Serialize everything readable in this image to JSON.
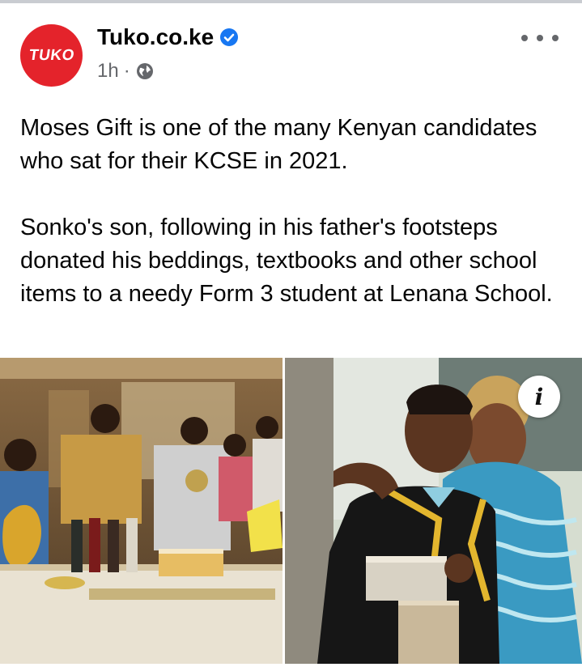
{
  "post": {
    "page_name": "Tuko.co.ke",
    "logo_text": "TUKO",
    "time": "1h",
    "separator": "·",
    "verified_icon": "verified-badge-icon",
    "privacy_icon": "globe-icon",
    "more_icon": "more-options-icon",
    "paragraphs": [
      "Moses Gift is one of the many Kenyan candidates who sat for their KCSE in 2021.",
      "Sonko's son, following in his father's footsteps donated his beddings, textbooks and other school items to a needy Form 3 student at Lenana School."
    ]
  },
  "media": {
    "info_label": "i"
  },
  "colors": {
    "brand": "#e4232b",
    "verified": "#1877f2",
    "meta": "#65676b",
    "text": "#050505"
  }
}
